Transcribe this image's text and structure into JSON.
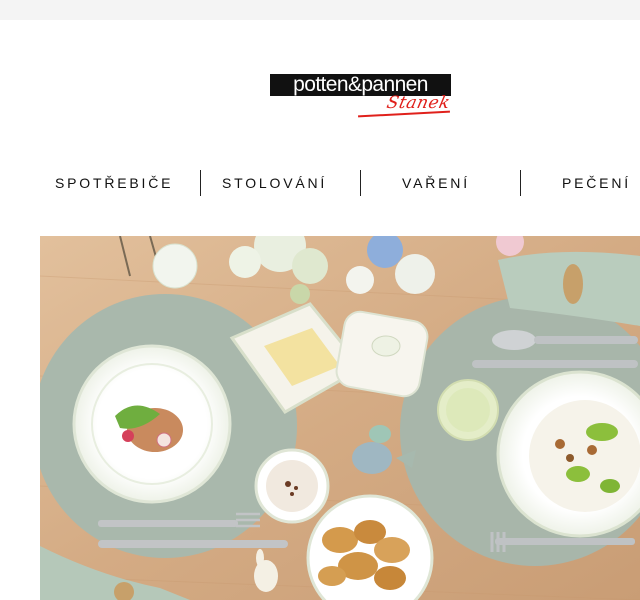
{
  "brand": {
    "logo_text": "potten&pannen",
    "logo_script": "Stanek"
  },
  "nav": {
    "items": [
      {
        "label": "SPOTŘEBIČE"
      },
      {
        "label": "STOLOVÁNÍ"
      },
      {
        "label": "VAŘENÍ"
      },
      {
        "label": "PEČENÍ"
      }
    ]
  },
  "colors": {
    "logo_red": "#e0201b",
    "placemat": "#a9b8ac",
    "table_wood": "#d9b48e"
  },
  "hero": {
    "icon": "easter-table-setting-photo"
  }
}
